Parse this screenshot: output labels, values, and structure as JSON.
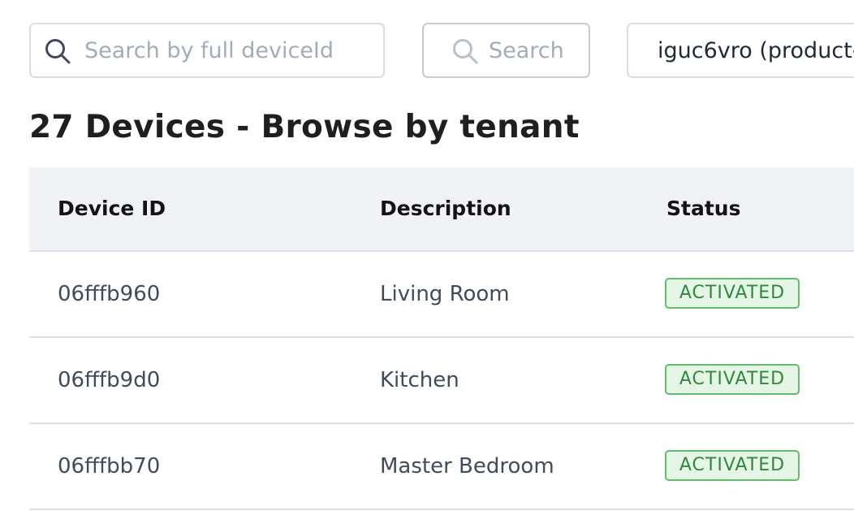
{
  "search": {
    "placeholder": "Search by full deviceId",
    "value": ""
  },
  "search_button": {
    "label": "Search"
  },
  "tenant_select": {
    "value": "iguc6vro (product-"
  },
  "page_title": "27 Devices - Browse by tenant",
  "table": {
    "headers": [
      "Device ID",
      "Description",
      "Status"
    ],
    "rows": [
      {
        "device_id": "06fffb960",
        "description": "Living Room",
        "status": "ACTIVATED"
      },
      {
        "device_id": "06fffb9d0",
        "description": "Kitchen",
        "status": "ACTIVATED"
      },
      {
        "device_id": "06fffbb70",
        "description": "Master Bedroom",
        "status": "ACTIVATED"
      }
    ]
  },
  "icons": {
    "search_input_icon": "search-icon",
    "search_button_icon": "search-icon"
  },
  "colors": {
    "header_bg": "#f0f2f6",
    "status_activated_border": "#5ebf6a",
    "status_activated_bg": "#e5f6e6",
    "status_activated_text": "#2e8a3a",
    "placeholder_text": "#a3acbb"
  }
}
